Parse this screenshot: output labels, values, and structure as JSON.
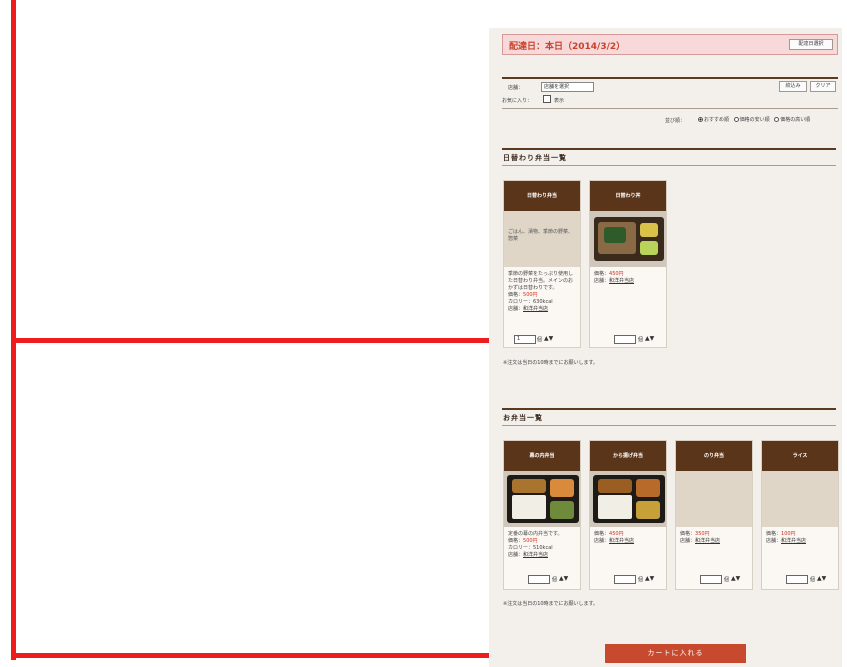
{
  "header": {
    "date_label": "配達日：本日（2014/3/2）",
    "change_button": "配達日選択"
  },
  "filters": {
    "store_label": "店舗：",
    "store_select": "店舗を選択",
    "favorite_label": "お気に入り：",
    "favorite_check_label": "表示",
    "search_button": "絞込み",
    "clear_button": "クリア",
    "sort_label": "並び順：",
    "sort_options": [
      "おすすめ順",
      "価格の安い順",
      "価格の高い順"
    ],
    "sort_selected": 0
  },
  "daily": {
    "title": "日替わり弁当一覧",
    "cards": [
      {
        "name": "日替わり弁当",
        "image_text": "ごはん、漬物、季節の野菜、惣菜",
        "description": "季節の野菜をたっぷり使用した日替わり弁当。メインのおかずは日替わりです。",
        "price_label": "価格：",
        "price": "500円",
        "calorie": "カロリー：630kcal",
        "store_label": "店舗：",
        "store": "和洋弁当店",
        "qty": "1",
        "unit": "個"
      },
      {
        "name": "日替わり丼",
        "price_label": "価格：",
        "price": "450円",
        "store_label": "店舗：",
        "store": "和洋弁当店",
        "qty": "",
        "unit": "個"
      }
    ],
    "note": "※注文は当日の10時までにお願いします。"
  },
  "bento": {
    "title": "お弁当一覧",
    "cards": [
      {
        "name": "幕の内弁当",
        "description": "定番の幕の内弁当です。",
        "price_label": "価格：",
        "price": "500円",
        "calorie": "カロリー：510kcal",
        "store_label": "店舗：",
        "store": "和洋弁当店",
        "qty": "",
        "unit": "個"
      },
      {
        "name": "から揚げ弁当",
        "price_label": "価格：",
        "price": "450円",
        "store_label": "店舗：",
        "store": "和洋弁当店",
        "qty": "",
        "unit": "個"
      },
      {
        "name": "のり弁当",
        "price_label": "価格：",
        "price": "350円",
        "store_label": "店舗：",
        "store": "和洋弁当店",
        "qty": "",
        "unit": "個"
      },
      {
        "name": "ライス",
        "price_label": "価格：",
        "price": "100円",
        "store_label": "店舗：",
        "store": "和洋弁当店",
        "qty": "",
        "unit": "個"
      }
    ],
    "note": "※注文は当日の10時までにお願いします。"
  },
  "cart_button": "カートに入れる",
  "colors": {
    "accent": "#ee1c1c",
    "header_brown": "#5a351a",
    "cart_red": "#c74a2f"
  }
}
